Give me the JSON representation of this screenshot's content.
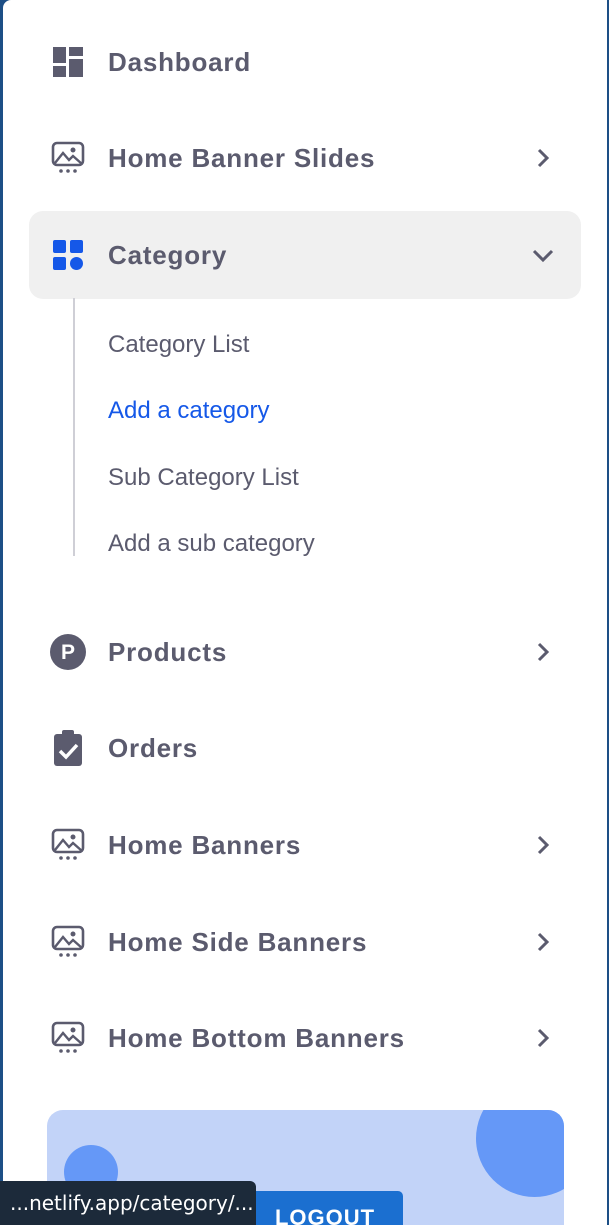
{
  "nav": {
    "items": [
      {
        "label": "Dashboard",
        "icon": "dashboard-icon"
      },
      {
        "label": "Home Banner Slides",
        "icon": "image-icon"
      },
      {
        "label": "Category",
        "icon": "category-grid-icon"
      },
      {
        "label": "Products",
        "icon": "products-p-icon"
      },
      {
        "label": "Orders",
        "icon": "clipboard-check-icon"
      },
      {
        "label": "Home Banners",
        "icon": "image-icon"
      },
      {
        "label": "Home Side Banners",
        "icon": "image-icon"
      },
      {
        "label": "Home Bottom Banners",
        "icon": "image-icon"
      }
    ],
    "category_sub": [
      "Category List",
      "Add a category",
      "Sub Category List",
      "Add a sub category"
    ]
  },
  "promo": {
    "logout_label": "LOGOUT"
  },
  "status_bar": {
    "url": "...netlify.app/category/..."
  },
  "colors": {
    "accent": "#1558e8",
    "text": "#5b5b6e",
    "active_bg": "#f0f0f0",
    "promo_bg": "#c2d3f8"
  }
}
